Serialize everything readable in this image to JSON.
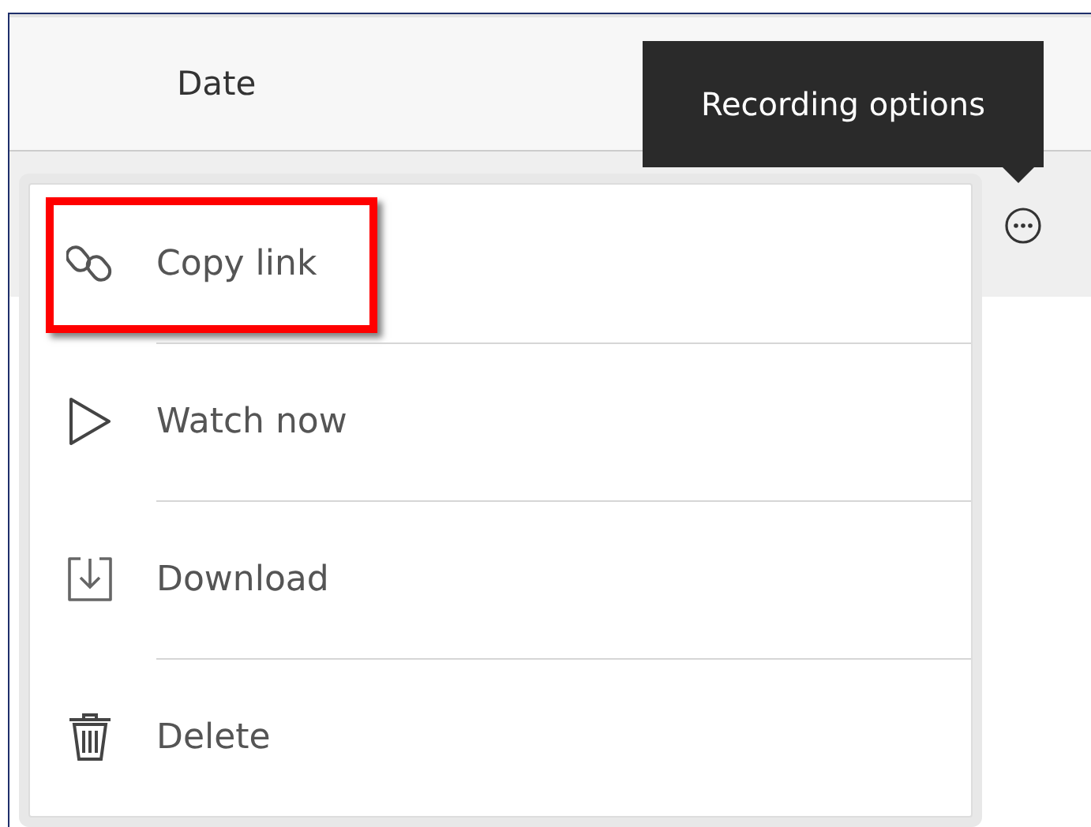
{
  "table": {
    "columns": [
      "Date"
    ]
  },
  "tooltip": {
    "text": "Recording options"
  },
  "options_button": {
    "kind": "more"
  },
  "menu": {
    "items": [
      {
        "label": "Copy link",
        "kind": "link",
        "highlighted": true
      },
      {
        "label": "Watch now",
        "kind": "play",
        "highlighted": false
      },
      {
        "label": "Download",
        "kind": "download",
        "highlighted": false
      },
      {
        "label": "Delete",
        "kind": "delete",
        "highlighted": false
      }
    ]
  }
}
